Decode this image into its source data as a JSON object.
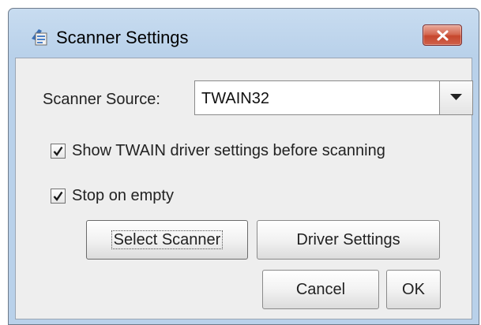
{
  "window": {
    "title": "Scanner Settings",
    "icon": "scanner-icon",
    "close_icon": "close-icon"
  },
  "source": {
    "label": "Scanner Source:",
    "selected": "TWAIN32"
  },
  "options": {
    "show_driver": {
      "label": "Show TWAIN driver settings before scanning",
      "checked": true
    },
    "stop_on_empty": {
      "label": "Stop on empty",
      "checked": true
    }
  },
  "buttons": {
    "select_scanner": "Select Scanner",
    "driver_settings": "Driver Settings",
    "cancel": "Cancel",
    "ok": "OK"
  },
  "colors": {
    "title_bar": "#b9d1ea",
    "dialog_bg": "#eeeeee",
    "close_button": "#c6472d"
  }
}
